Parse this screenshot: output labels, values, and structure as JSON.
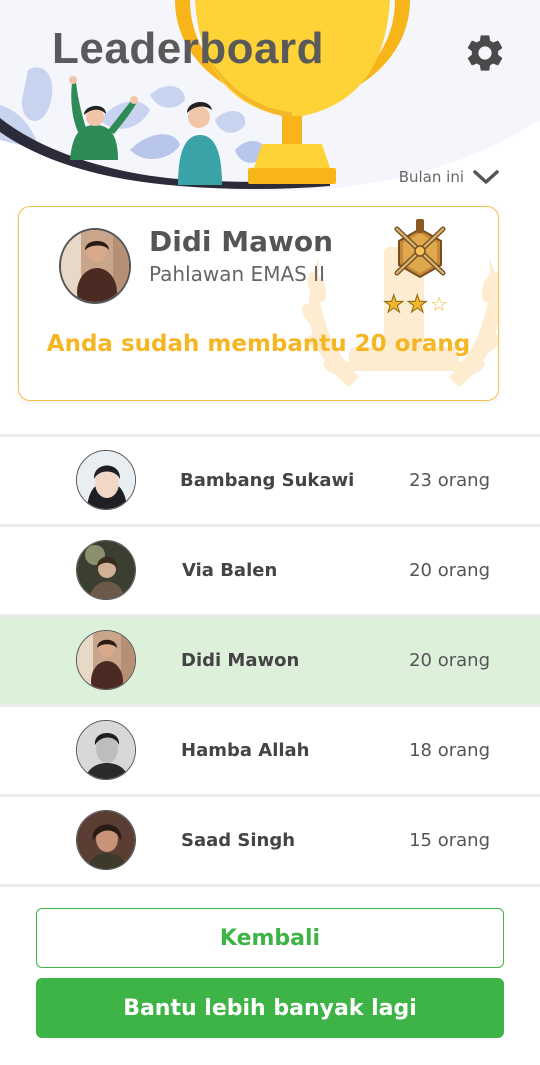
{
  "header": {
    "title": "Leaderboard",
    "settings_icon": "gear-icon"
  },
  "period": {
    "label": "Bulan ini",
    "icon": "chevron-down-icon"
  },
  "profile": {
    "name": "Didi Mawon",
    "rank": "Pahlawan EMAS II",
    "badge_icon": "crossed-swords-badge-icon",
    "stars_filled": 2,
    "stars_total": 3,
    "help_text": "Anda sudah membantu 20 orang"
  },
  "leaderboard": [
    {
      "name": "Bambang Sukawi",
      "count": "23 orang",
      "active": false
    },
    {
      "name": "Via Balen",
      "count": "20 orang",
      "active": false
    },
    {
      "name": "Didi Mawon",
      "count": "20 orang",
      "active": true
    },
    {
      "name": "Hamba Allah",
      "count": "18 orang",
      "active": false
    },
    {
      "name": "Saad Singh",
      "count": "15 orang",
      "active": false
    }
  ],
  "buttons": {
    "back_label": "Kembali",
    "help_more_label": "Bantu lebih banyak lagi"
  },
  "colors": {
    "accent_green": "#3db445",
    "accent_gold": "#f6b623",
    "active_row": "#dcf0da"
  }
}
